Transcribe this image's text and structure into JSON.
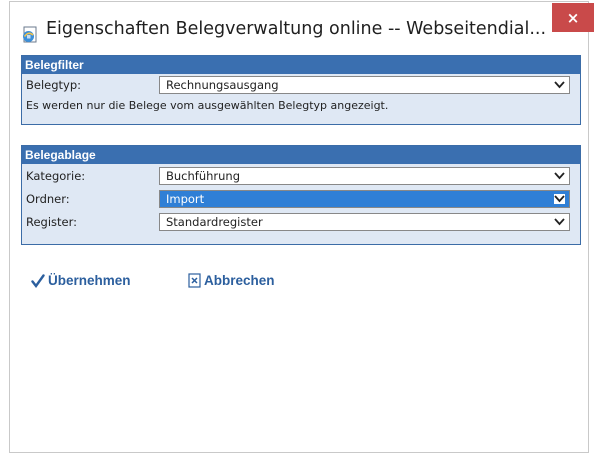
{
  "window": {
    "title": "Eigenschaften Belegverwaltung online -- Webseitendial...",
    "close_glyph": "×"
  },
  "belegfilter": {
    "header": "Belegfilter",
    "belegtyp_label": "Belegtyp:",
    "belegtyp_value": "Rechnungsausgang",
    "hint": "Es werden nur die Belege vom ausgewählten Belegtyp angezeigt."
  },
  "belegablage": {
    "header": "Belegablage",
    "kategorie_label": "Kategorie:",
    "kategorie_value": "Buchführung",
    "ordner_label": "Ordner:",
    "ordner_value": "Import",
    "register_label": "Register:",
    "register_value": "Standardregister"
  },
  "actions": {
    "apply_label": "Übernehmen",
    "cancel_label": "Abbrechen"
  },
  "icons": {
    "app": "ie-page-icon",
    "close": "close-icon",
    "dropdown": "chevron-down-icon",
    "apply": "checkmark-icon",
    "cancel": "cancel-document-icon"
  },
  "colors": {
    "group_header": "#3a6fb0",
    "group_body": "#dfe8f4",
    "selected_option": "#2f7fd6",
    "close_button": "#c94a4a",
    "action_text": "#2c5f9e"
  }
}
